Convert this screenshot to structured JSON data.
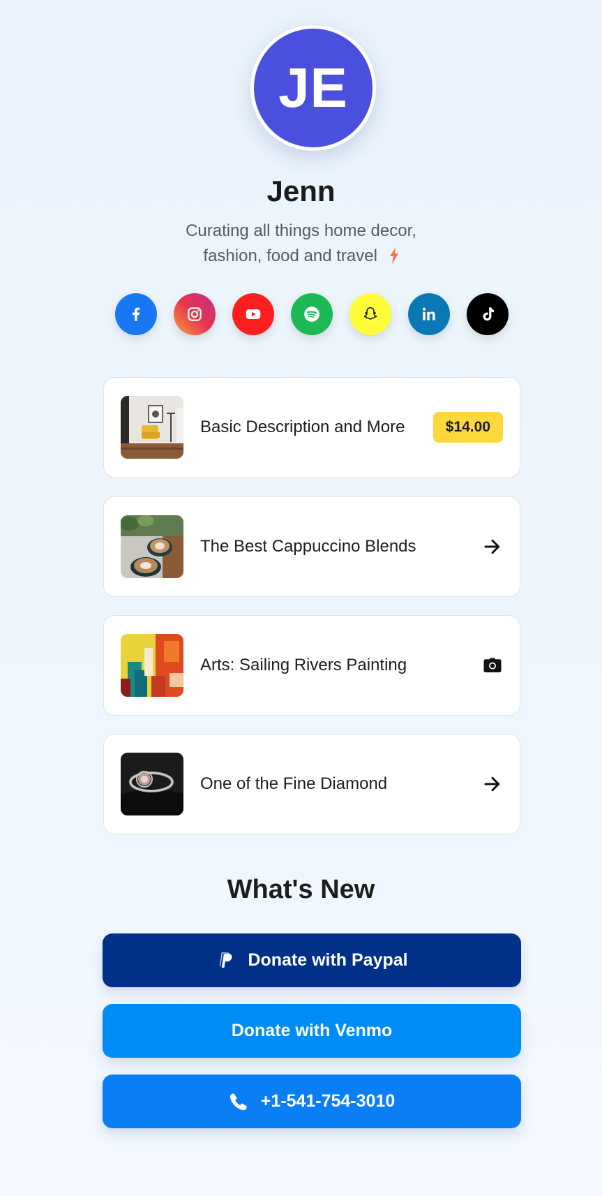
{
  "profile": {
    "initials": "JE",
    "name": "Jenn",
    "bio_line1": "Curating all things home decor,",
    "bio_line2": "fashion, food and travel"
  },
  "socials": [
    {
      "icon": "facebook-icon",
      "color": "#1877f2"
    },
    {
      "icon": "instagram-icon",
      "color": "#e1306c"
    },
    {
      "icon": "youtube-icon",
      "color": "#ff1f1f"
    },
    {
      "icon": "spotify-icon",
      "color": "#1db954"
    },
    {
      "icon": "snapchat-icon",
      "color": "#fffc3a"
    },
    {
      "icon": "linkedin-icon",
      "color": "#0a78b5"
    },
    {
      "icon": "tiktok-icon",
      "color": "#000000"
    }
  ],
  "links": [
    {
      "title": "Basic Description and More",
      "badge": "$14.00",
      "thumb": "living-room-photo"
    },
    {
      "title": "The Best Cappuccino Blends",
      "trail": "arrow-right-icon",
      "thumb": "cappuccino-photo"
    },
    {
      "title": "Arts: Sailing Rivers Painting",
      "trail": "camera-icon",
      "thumb": "painting-photo"
    },
    {
      "title": "One of the Fine Diamond",
      "trail": "arrow-right-icon",
      "thumb": "diamond-ring-photo"
    }
  ],
  "whats_new": {
    "title": "What's New",
    "paypal_label": "Donate with Paypal",
    "venmo_label": "Donate with Venmo",
    "phone_label": "+1-541-754-3010"
  },
  "colors": {
    "avatar": "#4a4fdd",
    "price_badge": "#fdd83a",
    "paypal": "#003087",
    "venmo": "#008cf5",
    "phone": "#0a7ff5"
  }
}
